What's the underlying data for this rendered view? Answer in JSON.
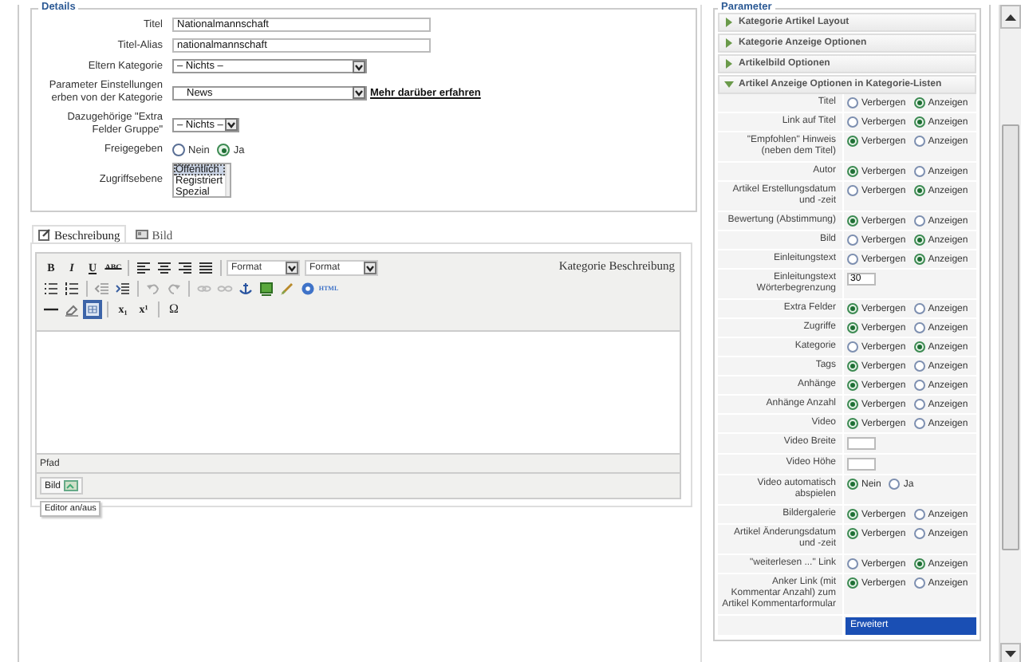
{
  "details": {
    "legend": "Details",
    "fields": [
      {
        "kind": "text",
        "label": "Titel",
        "value": "Nationalmannschaft"
      },
      {
        "kind": "text",
        "label": "Titel-Alias",
        "value": "nationalmannschaft"
      },
      {
        "kind": "select",
        "label": "Eltern Kategorie",
        "value": "– Nichts –"
      },
      {
        "kind": "select",
        "label": "Parameter Einstellungen erben von der Kategorie",
        "value": "News",
        "link": "Mehr darüber erfahren"
      },
      {
        "kind": "smallselect",
        "label": "Dazugehörige \"Extra Felder Gruppe\"",
        "value": "– Nichts –"
      },
      {
        "kind": "radio",
        "label": "Freigegeben",
        "options": [
          {
            "label": "Nein",
            "selected": false
          },
          {
            "label": "Ja",
            "selected": true
          }
        ]
      },
      {
        "kind": "listbox",
        "label": "Zugriffsebene",
        "options": [
          {
            "label": "Öffentlich",
            "selected": true
          },
          {
            "label": "Registriert",
            "selected": false
          },
          {
            "label": "Spezial",
            "selected": false
          }
        ]
      }
    ]
  },
  "editor": {
    "tabs": [
      {
        "kind": "note",
        "label": "Beschreibung",
        "selected": true
      },
      {
        "kind": "picture",
        "label": "Bild",
        "selected": false
      }
    ],
    "title": "Kategorie Beschreibung",
    "toolbar": [
      [
        {
          "kind": "bold",
          "text": "B"
        },
        {
          "kind": "italic",
          "text": "I"
        },
        {
          "kind": "underline",
          "text": "U"
        },
        {
          "kind": "strike",
          "text": "ABC"
        },
        {
          "kind": "sep"
        },
        {
          "kind": "alignleft"
        },
        {
          "kind": "aligncenter"
        },
        {
          "kind": "alignright"
        },
        {
          "kind": "justify"
        },
        {
          "kind": "sep"
        },
        {
          "kind": "format",
          "text": "Format"
        },
        {
          "kind": "format",
          "text": "Format"
        }
      ],
      [
        {
          "kind": "bullist"
        },
        {
          "kind": "numlist"
        },
        {
          "kind": "sep"
        },
        {
          "kind": "outdent"
        },
        {
          "kind": "indent"
        },
        {
          "kind": "sep"
        },
        {
          "kind": "undo"
        },
        {
          "kind": "redo"
        },
        {
          "kind": "sep"
        },
        {
          "kind": "link"
        },
        {
          "kind": "unlink"
        },
        {
          "kind": "anchor"
        },
        {
          "kind": "image"
        },
        {
          "kind": "cleanup"
        },
        {
          "kind": "help"
        },
        {
          "kind": "html",
          "text": "HTML"
        }
      ],
      [
        {
          "kind": "hr"
        },
        {
          "kind": "eraser"
        },
        {
          "kind": "table"
        },
        {
          "kind": "sep"
        },
        {
          "kind": "sub",
          "text": "x₁"
        },
        {
          "kind": "sup",
          "text": "x¹"
        },
        {
          "kind": "sep"
        },
        {
          "kind": "char",
          "text": "Ω"
        }
      ]
    ],
    "path_label": "Pfad",
    "toggle_button": "Bild",
    "tooltip": "Editor an/aus"
  },
  "params": {
    "legend": "Parameter",
    "panels": [
      {
        "title": "Kategorie Artikel Layout",
        "expanded": false
      },
      {
        "title": "Kategorie Anzeige Optionen",
        "expanded": false
      },
      {
        "title": "Artikelbild Optionen",
        "expanded": false
      },
      {
        "title": "Artikel Anzeige Optionen in Kategorie-Listen",
        "expanded": true,
        "rows": [
          {
            "kind": "radio",
            "label": "Titel",
            "options": [
              {
                "label": "Verbergen",
                "selected": false
              },
              {
                "label": "Anzeigen",
                "selected": true
              }
            ]
          },
          {
            "kind": "radio",
            "label": "Link auf Titel",
            "options": [
              {
                "label": "Verbergen",
                "selected": false
              },
              {
                "label": "Anzeigen",
                "selected": true
              }
            ]
          },
          {
            "kind": "radio",
            "label": "\"Empfohlen\" Hinweis (neben dem Titel)",
            "options": [
              {
                "label": "Verbergen",
                "selected": true
              },
              {
                "label": "Anzeigen",
                "selected": false
              }
            ]
          },
          {
            "kind": "radio",
            "label": "Autor",
            "options": [
              {
                "label": "Verbergen",
                "selected": true
              },
              {
                "label": "Anzeigen",
                "selected": false
              }
            ]
          },
          {
            "kind": "radio",
            "label": "Artikel Erstellungsdatum und -zeit",
            "options": [
              {
                "label": "Verbergen",
                "selected": false
              },
              {
                "label": "Anzeigen",
                "selected": true
              }
            ]
          },
          {
            "kind": "radio",
            "label": "Bewertung (Abstimmung)",
            "options": [
              {
                "label": "Verbergen",
                "selected": true
              },
              {
                "label": "Anzeigen",
                "selected": false
              }
            ]
          },
          {
            "kind": "radio",
            "label": "Bild",
            "options": [
              {
                "label": "Verbergen",
                "selected": false
              },
              {
                "label": "Anzeigen",
                "selected": true
              }
            ]
          },
          {
            "kind": "radio",
            "label": "Einleitungstext",
            "options": [
              {
                "label": "Verbergen",
                "selected": false
              },
              {
                "label": "Anzeigen",
                "selected": true
              }
            ]
          },
          {
            "kind": "text",
            "label": "Einleitungstext Wörterbegrenzung",
            "value": "30"
          },
          {
            "kind": "radio",
            "label": "Extra Felder",
            "options": [
              {
                "label": "Verbergen",
                "selected": true
              },
              {
                "label": "Anzeigen",
                "selected": false
              }
            ]
          },
          {
            "kind": "radio",
            "label": "Zugriffe",
            "options": [
              {
                "label": "Verbergen",
                "selected": true
              },
              {
                "label": "Anzeigen",
                "selected": false
              }
            ]
          },
          {
            "kind": "radio",
            "label": "Kategorie",
            "options": [
              {
                "label": "Verbergen",
                "selected": false
              },
              {
                "label": "Anzeigen",
                "selected": true
              }
            ]
          },
          {
            "kind": "radio",
            "label": "Tags",
            "options": [
              {
                "label": "Verbergen",
                "selected": true
              },
              {
                "label": "Anzeigen",
                "selected": false
              }
            ]
          },
          {
            "kind": "radio",
            "label": "Anhänge",
            "options": [
              {
                "label": "Verbergen",
                "selected": true
              },
              {
                "label": "Anzeigen",
                "selected": false
              }
            ]
          },
          {
            "kind": "radio",
            "label": "Anhänge Anzahl",
            "options": [
              {
                "label": "Verbergen",
                "selected": true
              },
              {
                "label": "Anzeigen",
                "selected": false
              }
            ]
          },
          {
            "kind": "radio",
            "label": "Video",
            "options": [
              {
                "label": "Verbergen",
                "selected": true
              },
              {
                "label": "Anzeigen",
                "selected": false
              }
            ]
          },
          {
            "kind": "text",
            "label": "Video Breite"
          },
          {
            "kind": "text",
            "label": "Video Höhe"
          },
          {
            "kind": "radio",
            "label": "Video automatisch abspielen",
            "options": [
              {
                "label": "Nein",
                "selected": true
              },
              {
                "label": "Ja",
                "selected": false
              }
            ]
          },
          {
            "kind": "radio",
            "label": "Bildergalerie",
            "options": [
              {
                "label": "Verbergen",
                "selected": true
              },
              {
                "label": "Anzeigen",
                "selected": false
              }
            ]
          },
          {
            "kind": "radio",
            "label": "Artikel Änderungsdatum und -zeit",
            "options": [
              {
                "label": "Verbergen",
                "selected": true
              },
              {
                "label": "Anzeigen",
                "selected": false
              }
            ]
          },
          {
            "kind": "radio",
            "label": "\"weiterlesen ...\" Link",
            "options": [
              {
                "label": "Verbergen",
                "selected": false
              },
              {
                "label": "Anzeigen",
                "selected": true
              }
            ]
          },
          {
            "kind": "radio",
            "label": "Anker Link (mit Kommentar Anzahl) zum Artikel Kommentarformular",
            "options": [
              {
                "label": "Verbergen",
                "selected": true
              },
              {
                "label": "Anzeigen",
                "selected": false
              }
            ]
          }
        ]
      }
    ],
    "highlighted_option": "Erweitert"
  }
}
